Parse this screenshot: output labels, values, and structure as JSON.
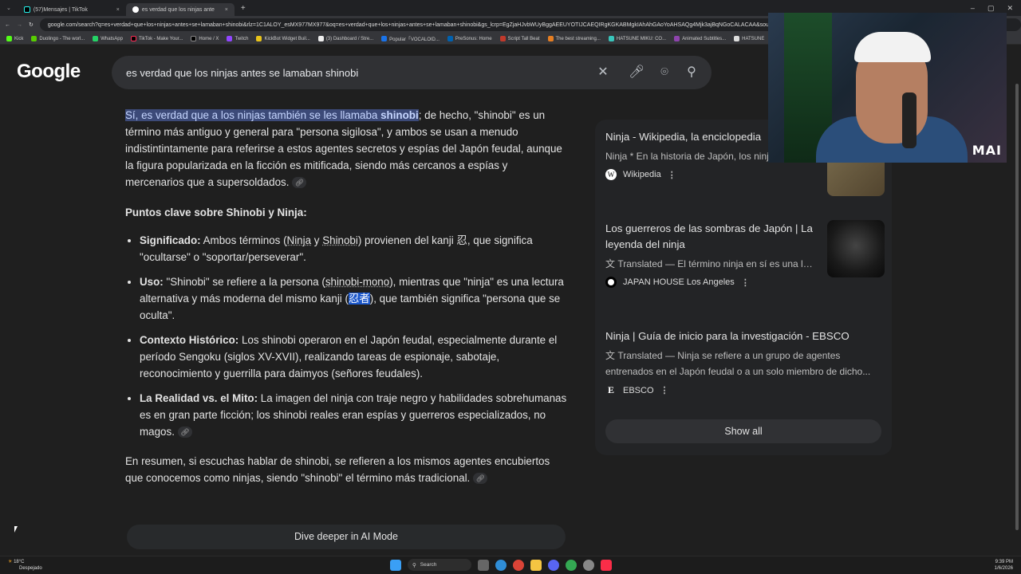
{
  "browser": {
    "tabs": [
      {
        "title": "(57)Mensajes | TikTok",
        "close": "×"
      },
      {
        "title": "es verdad que los ninjas ante",
        "close": "×"
      }
    ],
    "new_tab": "+",
    "url": "google.com/search?q=es+verdad+que+los+ninjas+antes+se+lamaban+shinobi&rlz=1C1ALOY_esMX977MX977&oq=es+verdad+que+los+ninjas+antes+se+lamaban+shinobi&gs_lcrp=EgZjaHJvbWUyBggAEEUYOTIJCAEQIRgKGKABMgkIAhAhGAoYoAHSAQg4Mjk3ajBqNGoCALACAA&sourceid=chrome",
    "bookmarks": [
      "Kick",
      "Duolingo - The worl...",
      "WhatsApp",
      "TikTok - Make Your...",
      "Home / X",
      "Twitch",
      "KickBot Widget Buil...",
      "(3) Dashboard / Stre...",
      "Popular「VOCALOID...",
      "PreSonus: Home",
      "Script Tall Beat",
      "The best streaming...",
      "HATSUNE MIKU: CO...",
      "Animated Subtitles...",
      "HATSUNE"
    ]
  },
  "google": {
    "logo": "Google",
    "query": "es verdad que los ninjas antes se lamaban shinobi"
  },
  "answer": {
    "intro_highlight": "Sí, es verdad que a los ninjas también se les llamaba ",
    "intro_highlight_bold": "shinobi",
    "intro_rest": "; de hecho, \"shinobi\" es un término más antiguo y general para \"persona sigilosa\", y ambos se usan a menudo indistintintamente para referirse a estos agentes secretos y espías del Japón feudal, aunque la figura popularizada en la ficción es mitificada, siendo más cercanos a espías y mercenarios que a supersoldados.",
    "key_points_title": "Puntos clave sobre Shinobi y Ninja:",
    "bullets": [
      {
        "label": "Significado:",
        "t1": " Ambos términos (",
        "l1": "Ninja",
        "t2": " y ",
        "l2": "Shinobi",
        "t3": ") provienen del kanji 忍, que significa \"ocultarse\" o \"soportar/perseverar\"."
      },
      {
        "label": "Uso:",
        "t1": " \"Shinobi\" se refiere a la persona (",
        "l1": "shinobi-mono",
        "t2": "), mientras que \"ninja\" es una lectura alternativa y más moderna del mismo kanji (",
        "kanji": "忍者",
        "t3": "), que también significa \"persona que se oculta\"."
      },
      {
        "label": "Contexto Histórico:",
        "text": " Los shinobi operaron en el Japón feudal, especialmente durante el período Sengoku (siglos XV-XVII), realizando tareas de espionaje, sabotaje, reconocimiento y guerrilla para daimyos (señores feudales)."
      },
      {
        "label": "La Realidad vs. el Mito:",
        "text": " La imagen del ninja con traje negro y habilidades sobrehumanas es en gran parte ficción; los shinobi reales eran espías y guerreros especializados, no magos."
      }
    ],
    "summary": "En resumen, si escuchas hablar de shinobi, se refieren a los mismos agentes encubiertos que conocemos como ninjas, siendo \"shinobi\" el término más tradicional.",
    "dive_button": "Dive deeper in AI Mode"
  },
  "sources": [
    {
      "title": "Ninja - Wikipedia, la enciclopedia",
      "desc": "Ninja * En la historia de Japón, los ninja (忍者) o shinobi (忍び) eran un grupo de...",
      "site": "Wikipedia"
    },
    {
      "title": "Los guerreros de las sombras de Japón | La leyenda del ninja",
      "desc": "Translated — El término ninja en sí es una lectura alternativa relativamente moderna del...",
      "site": "JAPAN HOUSE Los Angeles"
    },
    {
      "title": "Ninja | Guía de inicio para la investigación - EBSCO",
      "desc": "Translated — Ninja se refiere a un grupo de agentes entrenados en el Japón feudal o a un solo miembro de dicho...",
      "site": "EBSCO"
    }
  ],
  "show_all": "Show all",
  "webcam": {
    "label": "MAI"
  },
  "taskbar": {
    "temp": "18°C",
    "weather": "Despejado",
    "search": "Search",
    "time": "9:39 PM",
    "date": "1/6/2026"
  }
}
